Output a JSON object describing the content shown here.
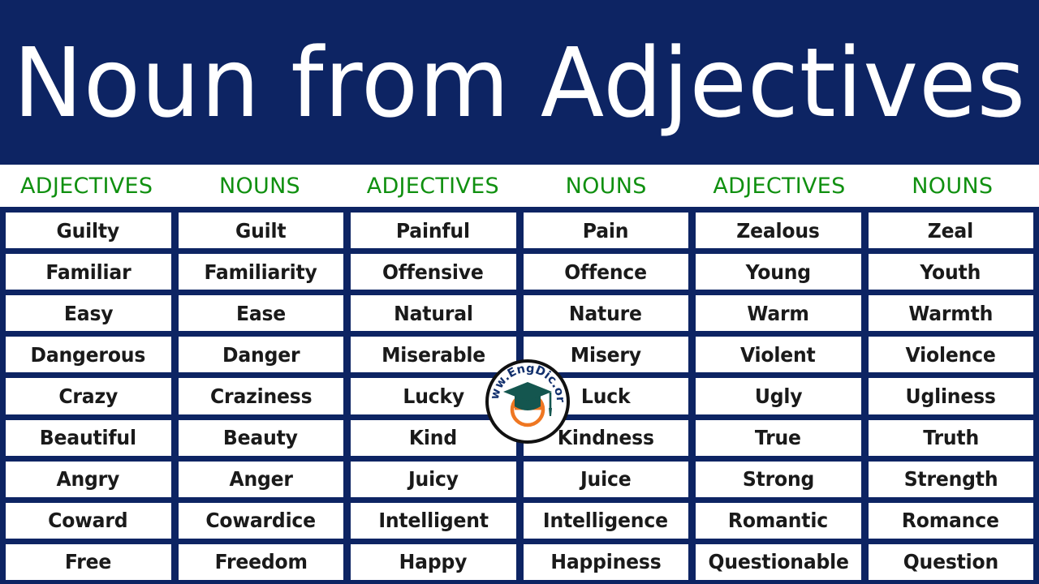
{
  "banner": {
    "title": "Noun from Adjectives",
    "background_color": "#0d2463",
    "text_color": "#ffffff"
  },
  "column_headers": {
    "color": "#109010",
    "labels": [
      "ADJECTIVES",
      "NOUNS",
      "ADJECTIVES",
      "NOUNS",
      "ADJECTIVES",
      "NOUNS"
    ]
  },
  "table": {
    "border_color": "#0d2463",
    "cell_background": "#ffffff",
    "cell_text_color": "#1a1a1a",
    "columns": 6,
    "rows": [
      [
        "Guilty",
        "Guilt",
        "Painful",
        "Pain",
        "Zealous",
        "Zeal"
      ],
      [
        "Familiar",
        "Familiarity",
        "Offensive",
        "Offence",
        "Young",
        "Youth"
      ],
      [
        "Easy",
        "Ease",
        "Natural",
        "Nature",
        "Warm",
        "Warmth"
      ],
      [
        "Dangerous",
        "Danger",
        "Miserable",
        "Misery",
        "Violent",
        "Violence"
      ],
      [
        "Crazy",
        "Craziness",
        "Lucky",
        "Luck",
        "Ugly",
        "Ugliness"
      ],
      [
        "Beautiful",
        "Beauty",
        "Kind",
        "Kindness",
        "True",
        "Truth"
      ],
      [
        "Angry",
        "Anger",
        "Juicy",
        "Juice",
        "Strong",
        "Strength"
      ],
      [
        "Coward",
        "Cowardice",
        "Intelligent",
        "Intelligence",
        "Romantic",
        "Romance"
      ],
      [
        "Free",
        "Freedom",
        "Happy",
        "Happiness",
        "Questionable",
        "Question"
      ]
    ]
  },
  "watermark": {
    "text": "www.EngDic.org",
    "letter": "e",
    "ring_color": "#111111",
    "text_color": "#12306d",
    "cap_color": "#14564f",
    "letter_color": "#ef7722"
  }
}
